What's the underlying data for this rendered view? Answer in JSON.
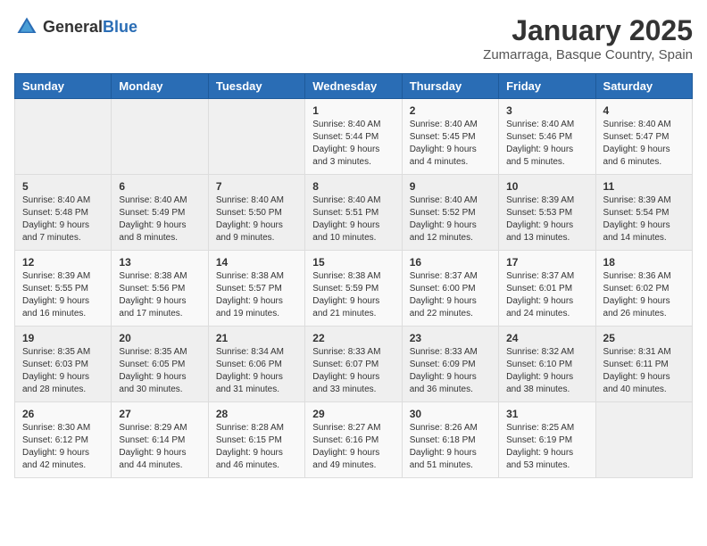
{
  "header": {
    "logo_general": "General",
    "logo_blue": "Blue",
    "title": "January 2025",
    "subtitle": "Zumarraga, Basque Country, Spain"
  },
  "days_of_week": [
    "Sunday",
    "Monday",
    "Tuesday",
    "Wednesday",
    "Thursday",
    "Friday",
    "Saturday"
  ],
  "weeks": [
    [
      {
        "day": "",
        "info": ""
      },
      {
        "day": "",
        "info": ""
      },
      {
        "day": "",
        "info": ""
      },
      {
        "day": "1",
        "info": "Sunrise: 8:40 AM\nSunset: 5:44 PM\nDaylight: 9 hours and 3 minutes."
      },
      {
        "day": "2",
        "info": "Sunrise: 8:40 AM\nSunset: 5:45 PM\nDaylight: 9 hours and 4 minutes."
      },
      {
        "day": "3",
        "info": "Sunrise: 8:40 AM\nSunset: 5:46 PM\nDaylight: 9 hours and 5 minutes."
      },
      {
        "day": "4",
        "info": "Sunrise: 8:40 AM\nSunset: 5:47 PM\nDaylight: 9 hours and 6 minutes."
      }
    ],
    [
      {
        "day": "5",
        "info": "Sunrise: 8:40 AM\nSunset: 5:48 PM\nDaylight: 9 hours and 7 minutes."
      },
      {
        "day": "6",
        "info": "Sunrise: 8:40 AM\nSunset: 5:49 PM\nDaylight: 9 hours and 8 minutes."
      },
      {
        "day": "7",
        "info": "Sunrise: 8:40 AM\nSunset: 5:50 PM\nDaylight: 9 hours and 9 minutes."
      },
      {
        "day": "8",
        "info": "Sunrise: 8:40 AM\nSunset: 5:51 PM\nDaylight: 9 hours and 10 minutes."
      },
      {
        "day": "9",
        "info": "Sunrise: 8:40 AM\nSunset: 5:52 PM\nDaylight: 9 hours and 12 minutes."
      },
      {
        "day": "10",
        "info": "Sunrise: 8:39 AM\nSunset: 5:53 PM\nDaylight: 9 hours and 13 minutes."
      },
      {
        "day": "11",
        "info": "Sunrise: 8:39 AM\nSunset: 5:54 PM\nDaylight: 9 hours and 14 minutes."
      }
    ],
    [
      {
        "day": "12",
        "info": "Sunrise: 8:39 AM\nSunset: 5:55 PM\nDaylight: 9 hours and 16 minutes."
      },
      {
        "day": "13",
        "info": "Sunrise: 8:38 AM\nSunset: 5:56 PM\nDaylight: 9 hours and 17 minutes."
      },
      {
        "day": "14",
        "info": "Sunrise: 8:38 AM\nSunset: 5:57 PM\nDaylight: 9 hours and 19 minutes."
      },
      {
        "day": "15",
        "info": "Sunrise: 8:38 AM\nSunset: 5:59 PM\nDaylight: 9 hours and 21 minutes."
      },
      {
        "day": "16",
        "info": "Sunrise: 8:37 AM\nSunset: 6:00 PM\nDaylight: 9 hours and 22 minutes."
      },
      {
        "day": "17",
        "info": "Sunrise: 8:37 AM\nSunset: 6:01 PM\nDaylight: 9 hours and 24 minutes."
      },
      {
        "day": "18",
        "info": "Sunrise: 8:36 AM\nSunset: 6:02 PM\nDaylight: 9 hours and 26 minutes."
      }
    ],
    [
      {
        "day": "19",
        "info": "Sunrise: 8:35 AM\nSunset: 6:03 PM\nDaylight: 9 hours and 28 minutes."
      },
      {
        "day": "20",
        "info": "Sunrise: 8:35 AM\nSunset: 6:05 PM\nDaylight: 9 hours and 30 minutes."
      },
      {
        "day": "21",
        "info": "Sunrise: 8:34 AM\nSunset: 6:06 PM\nDaylight: 9 hours and 31 minutes."
      },
      {
        "day": "22",
        "info": "Sunrise: 8:33 AM\nSunset: 6:07 PM\nDaylight: 9 hours and 33 minutes."
      },
      {
        "day": "23",
        "info": "Sunrise: 8:33 AM\nSunset: 6:09 PM\nDaylight: 9 hours and 36 minutes."
      },
      {
        "day": "24",
        "info": "Sunrise: 8:32 AM\nSunset: 6:10 PM\nDaylight: 9 hours and 38 minutes."
      },
      {
        "day": "25",
        "info": "Sunrise: 8:31 AM\nSunset: 6:11 PM\nDaylight: 9 hours and 40 minutes."
      }
    ],
    [
      {
        "day": "26",
        "info": "Sunrise: 8:30 AM\nSunset: 6:12 PM\nDaylight: 9 hours and 42 minutes."
      },
      {
        "day": "27",
        "info": "Sunrise: 8:29 AM\nSunset: 6:14 PM\nDaylight: 9 hours and 44 minutes."
      },
      {
        "day": "28",
        "info": "Sunrise: 8:28 AM\nSunset: 6:15 PM\nDaylight: 9 hours and 46 minutes."
      },
      {
        "day": "29",
        "info": "Sunrise: 8:27 AM\nSunset: 6:16 PM\nDaylight: 9 hours and 49 minutes."
      },
      {
        "day": "30",
        "info": "Sunrise: 8:26 AM\nSunset: 6:18 PM\nDaylight: 9 hours and 51 minutes."
      },
      {
        "day": "31",
        "info": "Sunrise: 8:25 AM\nSunset: 6:19 PM\nDaylight: 9 hours and 53 minutes."
      },
      {
        "day": "",
        "info": ""
      }
    ]
  ]
}
